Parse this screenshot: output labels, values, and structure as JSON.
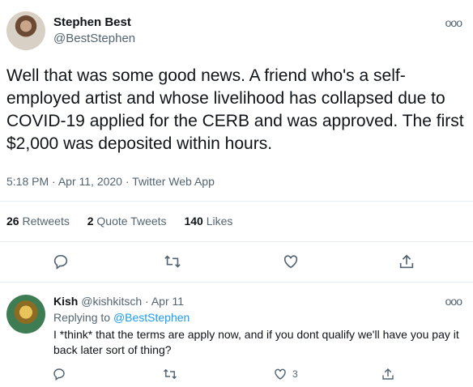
{
  "tweet": {
    "author_name": "Stephen Best",
    "author_handle": "@BestStephen",
    "text": "Well that was some good news. A friend who's a self-employed artist and whose livelihood has collapsed due to COVID-19 applied for the CERB and was approved. The first $2,000 was deposited within hours.",
    "time": "5:18 PM",
    "date": "Apr 11, 2020",
    "source": "Twitter Web App",
    "separator": "·",
    "stats": {
      "retweets_count": "26",
      "retweets_label": "Retweets",
      "quotes_count": "2",
      "quotes_label": "Quote Tweets",
      "likes_count": "140",
      "likes_label": "Likes"
    },
    "more_label": "ooo"
  },
  "reply": {
    "author_name": "Kish",
    "author_handle": "@kishkitsch",
    "date": "Apr 11",
    "separator": "·",
    "replying_prefix": "Replying to",
    "replying_to": "@BestStephen",
    "text": "I *think* that the terms are apply now, and if you dont qualify we'll have you pay it back later sort of thing?",
    "like_count": "3",
    "more_label": "ooo"
  },
  "colors": {
    "text": "#0f1419",
    "secondary": "#536471",
    "link": "#1d9bf0",
    "divider": "#e6ecf0"
  }
}
